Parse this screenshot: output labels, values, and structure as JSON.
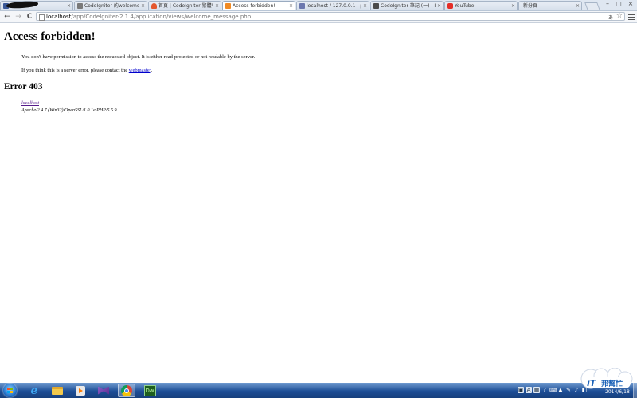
{
  "browser": {
    "tabs": [
      {
        "title": "",
        "favicon": "facebook-favicon",
        "color": "#3b5998",
        "active": false
      },
      {
        "title": "CodeIgniter 的welcome",
        "favicon": "codeigniter-favicon",
        "color": "#7a7a7a",
        "active": false
      },
      {
        "title": "首頁 | CodeIgniter 繁體中",
        "favicon": "fire-favicon",
        "color": "#e4572e",
        "active": false
      },
      {
        "title": "Access forbidden!",
        "favicon": "xampp-favicon",
        "color": "#f08a24",
        "active": true
      },
      {
        "title": "localhost / 127.0.0.1 | p",
        "favicon": "phpmyadmin-favicon",
        "color": "#6c78af",
        "active": false
      },
      {
        "title": "CodeIgniter 筆記 (一) - I",
        "favicon": "blog-favicon",
        "color": "#4a4a4a",
        "active": false
      },
      {
        "title": "YouTube",
        "favicon": "youtube-favicon",
        "color": "#e52d27",
        "active": false
      },
      {
        "title": "新分頁",
        "favicon": "",
        "color": "",
        "active": false
      }
    ],
    "close_glyph": "×",
    "window_controls": {
      "minimize": "–",
      "maximize": "□",
      "close": "×"
    },
    "nav": {
      "back": "←",
      "forward": "→",
      "reload": "C"
    },
    "address": {
      "host": "localhost",
      "path": "/app/CodeIgniter-2.1.4/application/views/welcome_message.php"
    },
    "translate_glyph": "あ",
    "bookmark_glyph": "☆"
  },
  "page": {
    "title": "Access forbidden!",
    "message": "You don't have permission to access the requested object. It is either read-protected or not readable by the server.",
    "contact_prefix": "If you think this is a server error, please contact the ",
    "contact_link": "webmaster",
    "contact_suffix": ".",
    "error_code": "Error 403",
    "server_host": "localhost",
    "server_signature": "Apache/2.4.7 (Win32) OpenSSL/1.0.1e PHP/5.5.9"
  },
  "taskbar": {
    "apps": [
      {
        "name": "internet-explorer",
        "active": false
      },
      {
        "name": "file-explorer",
        "active": false
      },
      {
        "name": "media-player",
        "active": false
      },
      {
        "name": "visual-studio",
        "active": false
      },
      {
        "name": "chrome",
        "active": true
      },
      {
        "name": "dreamweaver",
        "label": "Dw",
        "active": false
      }
    ],
    "tray_labels": [
      "▣",
      "A",
      "▦",
      "?",
      "⌨",
      "▲",
      "✎",
      "♪",
      "◧"
    ],
    "date": "2014/6/18",
    "accent": "#1d4e96"
  },
  "watermark": {
    "text": "iT邦幫忙"
  }
}
